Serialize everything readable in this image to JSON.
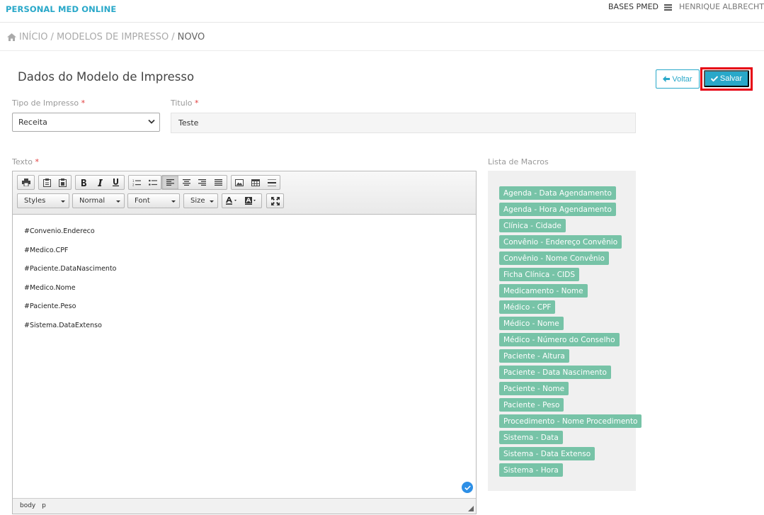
{
  "header": {
    "brand": "PERSONAL MED ONLINE",
    "bases_label": "BASES PMED",
    "user_name": "HENRIQUE ALBRECHT"
  },
  "breadcrumb": {
    "items": [
      "INÍCIO",
      "MODELOS DE IMPRESSO",
      "NOVO"
    ],
    "separator": "/"
  },
  "page": {
    "title": "Dados do Modelo de Impresso",
    "back_label": "Voltar",
    "save_label": "Salvar"
  },
  "form": {
    "tipo_label": "Tipo de Impresso",
    "tipo_value": "Receita",
    "titulo_label": "Titulo",
    "titulo_value": "Teste",
    "texto_label": "Texto",
    "required_mark": "*",
    "macros_label": "Lista de Macros"
  },
  "editor": {
    "combos": [
      "Styles",
      "Normal",
      "Font",
      "Size"
    ],
    "lines": [
      "#Convenio.Endereco",
      "#Medico.CPF",
      "#Paciente.DataNascimento",
      "#Medico.Nome",
      "#Paciente.Peso",
      "#Sistema.DataExtenso"
    ],
    "status_path": [
      "body",
      "p"
    ]
  },
  "macros": [
    "Agenda - Data Agendamento",
    "Agenda - Hora Agendamento",
    "Clínica - Cidade",
    "Convênio - Endereço Convênio",
    "Convênio - Nome Convênio",
    "Ficha Clínica - CIDS",
    "Medicamento - Nome",
    "Médico - CPF",
    "Médico - Nome",
    "Médico - Número do Conselho",
    "Paciente - Altura",
    "Paciente - Data Nascimento",
    "Paciente - Nome",
    "Paciente - Peso",
    "Procedimento - Nome Procedimento",
    "Sistema - Data",
    "Sistema - Data Extenso",
    "Sistema - Hora"
  ],
  "colors": {
    "brand": "#29a8c9",
    "macro_tag": "#77c3a7",
    "required": "#e03b3b",
    "highlight": "#e60012"
  }
}
